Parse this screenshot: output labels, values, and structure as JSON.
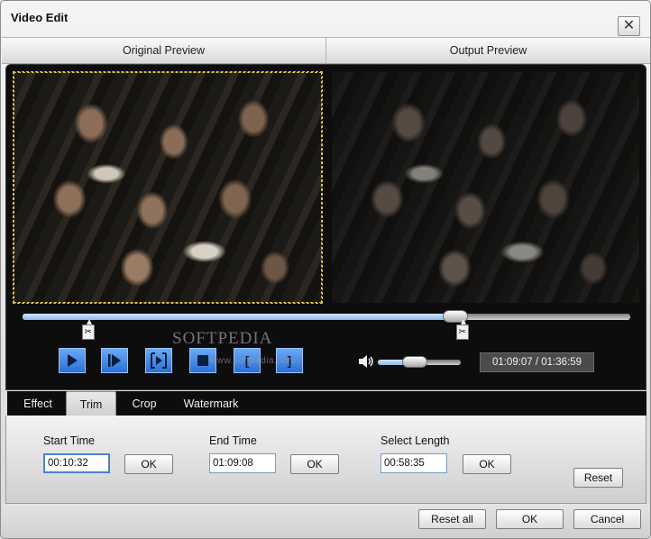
{
  "window": {
    "title": "Video Edit",
    "close_glyph": "✕"
  },
  "preview": {
    "original_label": "Original Preview",
    "output_label": "Output Preview"
  },
  "playback": {
    "current_time": "01:09:07",
    "total_time": "01:36:59",
    "time_display": "01:09:07 / 01:36:59",
    "seek_position_fraction": 0.712,
    "trim_start_fraction": 0.108,
    "trim_end_fraction": 0.712,
    "volume_fraction": 0.45
  },
  "controls": {
    "play": "play-icon",
    "next_frame": "step-forward-icon",
    "fit": "frame-fit-icon",
    "stop": "stop-icon",
    "mark_in": "[",
    "mark_out": "]"
  },
  "tabs": [
    {
      "label": "Effect",
      "active": false
    },
    {
      "label": "Trim",
      "active": true
    },
    {
      "label": "Crop",
      "active": false
    },
    {
      "label": "Watermark",
      "active": false
    }
  ],
  "watermark": {
    "text": "SOFTPEDIA",
    "sub": "www.softpedia.com"
  },
  "trim": {
    "start_time_label": "Start Time",
    "start_time_value": "00:10:32",
    "end_time_label": "End Time",
    "end_time_value": "01:09:08",
    "select_length_label": "Select Length",
    "select_length_value": "00:58:35",
    "ok_label": "OK",
    "reset_label": "Reset"
  },
  "footer": {
    "reset_all_label": "Reset all",
    "ok_label": "OK",
    "cancel_label": "Cancel"
  },
  "colors": {
    "accent": "#3a7fe0",
    "player_bg": "#0d0d0d",
    "crop_outline": "#d9c24a"
  }
}
